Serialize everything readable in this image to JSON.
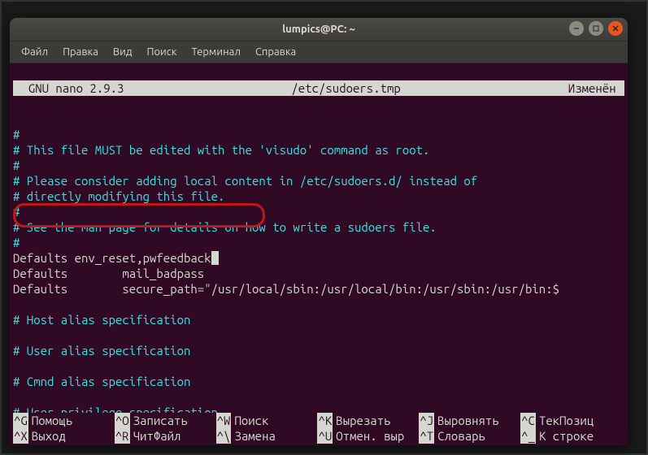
{
  "titlebar": {
    "title": "lumpics@PC: ~"
  },
  "menubar": {
    "items": [
      "Файл",
      "Правка",
      "Вид",
      "Поиск",
      "Терминал",
      "Справка"
    ]
  },
  "nano": {
    "version": "  GNU nano 2.9.3",
    "filepath": "/etc/sudoers.tmp",
    "status": "Изменён "
  },
  "lines": {
    "l0": "#",
    "l1": "# This file MUST be edited with the 'visudo' command as root.",
    "l2": "#",
    "l3": "# Please consider adding local content in /etc/sudoers.d/ instead of",
    "l4": "# directly modifying this file.",
    "l5": "#",
    "l6": "# See the man page for details on how to write a sudoers file.",
    "l7": "#",
    "l8": "Defaults env_reset,pwfeedback",
    "l9": "Defaults        mail_badpass",
    "l10": "Defaults        secure_path=\"/usr/local/sbin:/usr/local/bin:/usr/sbin:/usr/bin:$",
    "l11": "# Host alias specification",
    "l12": "# User alias specification",
    "l13": "# Cmnd alias specification",
    "l14": "# User privilege specification"
  },
  "shortcuts": {
    "row1": [
      {
        "key": "^G",
        "label": "Помощь"
      },
      {
        "key": "^O",
        "label": "Записать"
      },
      {
        "key": "^W",
        "label": "Поиск"
      },
      {
        "key": "^K",
        "label": "Вырезать"
      },
      {
        "key": "^J",
        "label": "Выровнять"
      },
      {
        "key": "^C",
        "label": "ТекПозиц"
      }
    ],
    "row2": [
      {
        "key": "^X",
        "label": "Выход"
      },
      {
        "key": "^R",
        "label": "ЧитФайл"
      },
      {
        "key": "^\\",
        "label": "Замена"
      },
      {
        "key": "^U",
        "label": "Отмен. выр"
      },
      {
        "key": "^T",
        "label": "Словарь"
      },
      {
        "key": "^_",
        "label": "К строке"
      }
    ]
  }
}
